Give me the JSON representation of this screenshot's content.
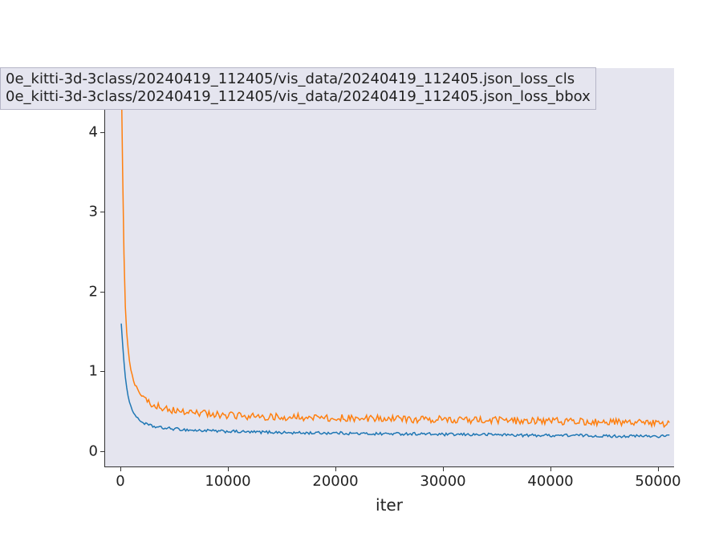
{
  "chart_data": {
    "type": "line",
    "xlabel": "iter",
    "ylabel": "",
    "title": "",
    "xlim": [
      -1500,
      51500
    ],
    "ylim": [
      -0.2,
      4.8
    ],
    "xticks": [
      0,
      10000,
      20000,
      30000,
      40000,
      50000
    ],
    "yticks": [
      0,
      1,
      2,
      3,
      4
    ],
    "series": [
      {
        "name": "0e_kitti-3d-3class/20240419_112405/vis_data/20240419_112405.json_loss_cls",
        "color": "#1f77b4",
        "x": [
          0,
          200,
          400,
          600,
          800,
          1000,
          1300,
          1600,
          2000,
          2500,
          3000,
          3500,
          4000,
          5000,
          6000,
          7000,
          8000,
          9000,
          10000,
          12000,
          14000,
          16000,
          18000,
          20000,
          22500,
          25000,
          27500,
          30000,
          32500,
          35000,
          37500,
          40000,
          42500,
          45000,
          47500,
          50000,
          51000
        ],
        "y": [
          1.6,
          1.2,
          0.9,
          0.72,
          0.6,
          0.52,
          0.45,
          0.4,
          0.36,
          0.33,
          0.31,
          0.3,
          0.29,
          0.28,
          0.27,
          0.26,
          0.26,
          0.25,
          0.25,
          0.24,
          0.24,
          0.23,
          0.23,
          0.23,
          0.22,
          0.22,
          0.22,
          0.21,
          0.21,
          0.21,
          0.2,
          0.2,
          0.2,
          0.19,
          0.19,
          0.19,
          0.19
        ]
      },
      {
        "name": "0e_kitti-3d-3class/20240419_112405/vis_data/20240419_112405.json_loss_bbox",
        "color": "#ff7f0e",
        "x": [
          0,
          100,
          200,
          350,
          500,
          700,
          900,
          1100,
          1400,
          1700,
          2000,
          2500,
          3000,
          3500,
          4000,
          5000,
          6000,
          7000,
          8000,
          9000,
          10000,
          12000,
          14000,
          16000,
          18000,
          20000,
          22500,
          25000,
          27500,
          30000,
          32500,
          35000,
          37500,
          40000,
          42500,
          45000,
          47500,
          50000,
          51000
        ],
        "y": [
          4.8,
          3.8,
          2.8,
          1.9,
          1.5,
          1.2,
          1.0,
          0.9,
          0.8,
          0.73,
          0.68,
          0.62,
          0.58,
          0.56,
          0.54,
          0.51,
          0.49,
          0.48,
          0.47,
          0.46,
          0.45,
          0.44,
          0.43,
          0.43,
          0.42,
          0.42,
          0.41,
          0.41,
          0.4,
          0.4,
          0.39,
          0.39,
          0.38,
          0.38,
          0.37,
          0.37,
          0.36,
          0.35,
          0.35
        ]
      }
    ]
  },
  "legend": {
    "entries": [
      "0e_kitti-3d-3class/20240419_112405/vis_data/20240419_112405.json_loss_cls",
      "0e_kitti-3d-3class/20240419_112405/vis_data/20240419_112405.json_loss_bbox"
    ]
  },
  "axes": {
    "xlabel": "iter",
    "xticks": [
      "0",
      "10000",
      "20000",
      "30000",
      "40000",
      "50000"
    ],
    "yticks": [
      "0",
      "1",
      "2",
      "3",
      "4"
    ]
  }
}
